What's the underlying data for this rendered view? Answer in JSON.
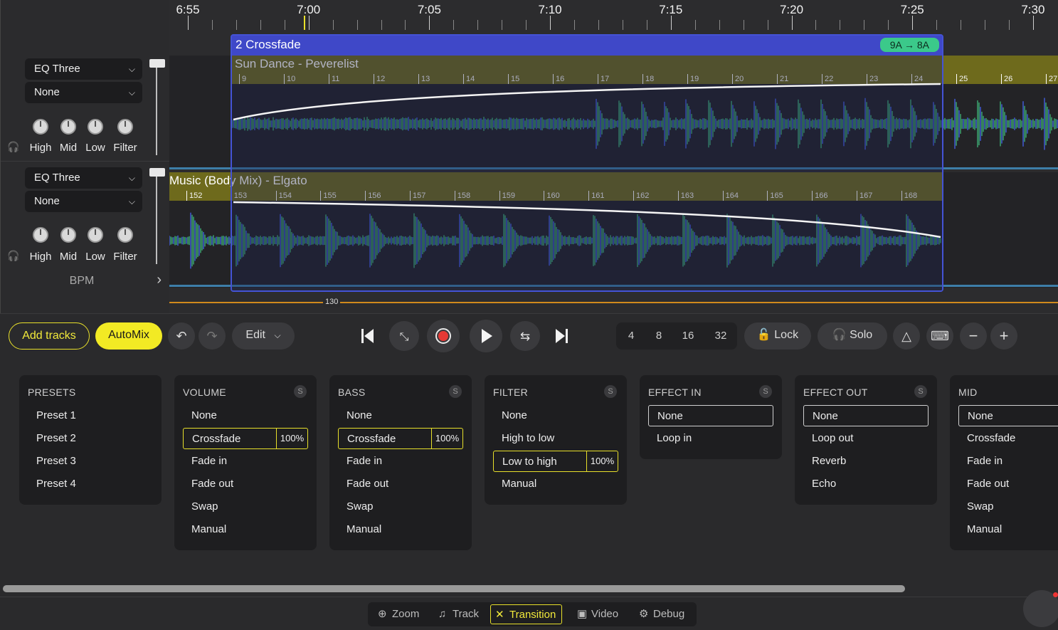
{
  "ruler": {
    "labels": [
      "6:55",
      "7:00",
      "7:05",
      "7:10",
      "7:15",
      "7:20",
      "7:25",
      "7:30"
    ]
  },
  "decks": [
    {
      "effect": "EQ Three",
      "preset": "None",
      "knobs": [
        "High",
        "Mid",
        "Low",
        "Filter"
      ]
    },
    {
      "effect": "EQ Three",
      "preset": "None",
      "knobs": [
        "High",
        "Mid",
        "Low",
        "Filter"
      ]
    }
  ],
  "bpm_label": "BPM",
  "crossfade": {
    "title": "2 Crossfade",
    "key": "9A → 8A"
  },
  "track1": {
    "title": "Sun Dance - Peverelist",
    "bars": [
      "9",
      "10",
      "11",
      "12",
      "13",
      "14",
      "15",
      "16",
      "17",
      "18",
      "19",
      "20",
      "21",
      "22",
      "23",
      "24",
      "25",
      "26",
      "27"
    ]
  },
  "track2": {
    "title": "Music (Body Mix) - Elgato",
    "bars": [
      "152",
      "153",
      "154",
      "155",
      "156",
      "157",
      "158",
      "159",
      "160",
      "161",
      "162",
      "163",
      "164",
      "165",
      "166",
      "167",
      "168"
    ]
  },
  "bpm_marker": "130",
  "toolbar": {
    "add_tracks": "Add tracks",
    "automix": "AutoMix",
    "edit": "Edit",
    "loop_sizes": [
      "4",
      "8",
      "16",
      "32"
    ],
    "lock": "Lock",
    "solo": "Solo"
  },
  "panels": {
    "presets": {
      "title": "PRESETS",
      "items": [
        "Preset 1",
        "Preset 2",
        "Preset 3",
        "Preset 4"
      ]
    },
    "volume": {
      "title": "VOLUME",
      "s": "S",
      "items": [
        "None",
        "Crossfade",
        "Fade in",
        "Fade out",
        "Swap",
        "Manual"
      ],
      "active": "Crossfade",
      "pct": "100%"
    },
    "bass": {
      "title": "BASS",
      "s": "S",
      "items": [
        "None",
        "Crossfade",
        "Fade in",
        "Fade out",
        "Swap",
        "Manual"
      ],
      "active": "Crossfade",
      "pct": "100%"
    },
    "filter": {
      "title": "FILTER",
      "s": "S",
      "items": [
        "None",
        "High to low",
        "Low to high",
        "Manual"
      ],
      "active": "Low to high",
      "pct": "100%"
    },
    "effect_in": {
      "title": "EFFECT IN",
      "s": "S",
      "items": [
        "None",
        "Loop in"
      ]
    },
    "effect_out": {
      "title": "EFFECT OUT",
      "s": "S",
      "items": [
        "None",
        "Loop out",
        "Reverb",
        "Echo"
      ]
    },
    "mid": {
      "title": "MID",
      "items": [
        "None",
        "Crossfade",
        "Fade in",
        "Fade out",
        "Swap",
        "Manual"
      ]
    }
  },
  "bottom_tabs": [
    {
      "label": "Zoom",
      "icon": "zoom-icon"
    },
    {
      "label": "Track",
      "icon": "music-note-icon"
    },
    {
      "label": "Transition",
      "icon": "transition-icon"
    },
    {
      "label": "Video",
      "icon": "video-icon"
    },
    {
      "label": "Debug",
      "icon": "bug-icon"
    }
  ],
  "colors": {
    "accent": "#f2ea24",
    "crossfade": "#3f48c8",
    "key_badge": "#3bc98a",
    "track_band": "#6e6a1c",
    "bpm_line": "#d08a1c"
  }
}
